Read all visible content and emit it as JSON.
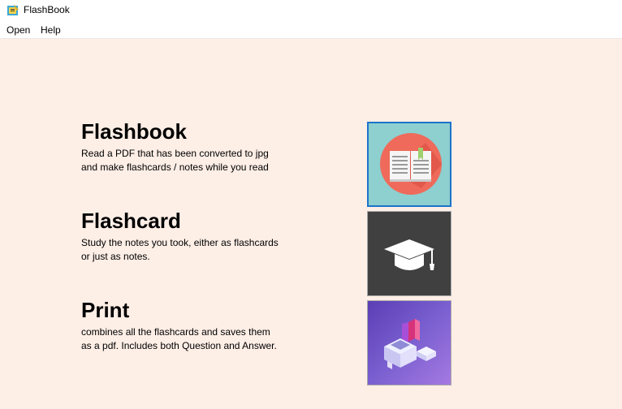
{
  "window": {
    "title": "FlashBook",
    "icon": "flashbook-app-icon"
  },
  "menu": {
    "items": [
      "Open",
      "Help"
    ]
  },
  "sections": [
    {
      "title": "Flashbook",
      "desc_line1": "Read a PDF that has been converted to jpg",
      "desc_line2": "and make flashcards / notes while you read",
      "icon": "open-book-icon",
      "tile_color": "#8ecfcf"
    },
    {
      "title": "Flashcard",
      "desc_line1": "Study the notes you took, either as flashcards",
      "desc_line2": "or just as notes.",
      "icon": "graduation-cap-icon",
      "tile_color": "#404040"
    },
    {
      "title": "Print",
      "desc_line1": "combines all the flashcards and saves them",
      "desc_line2": "as a pdf. Includes both Question and Answer.",
      "icon": "printer-icon",
      "tile_color": "#6a4cc4"
    }
  ],
  "colors": {
    "background": "#fdeee6",
    "selected_border": "#1c74c9"
  }
}
